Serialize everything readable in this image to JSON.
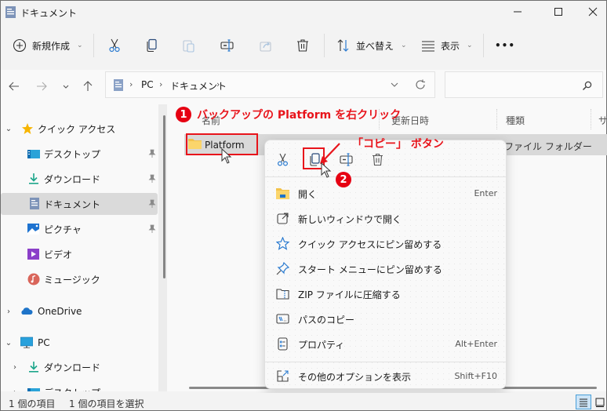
{
  "window": {
    "title": "ドキュメント",
    "controls": {
      "minimize": "minimize",
      "maximize": "maximize",
      "close": "close"
    }
  },
  "toolbar": {
    "new_label": "新規作成",
    "sort_label": "並べ替え",
    "view_label": "表示",
    "more_label": "•••",
    "icons": [
      "cut-icon",
      "copy-icon",
      "paste-icon",
      "rename-icon",
      "share-icon",
      "delete-icon"
    ]
  },
  "address": {
    "crumbs": [
      "PC",
      "ドキュメント"
    ],
    "search_placeholder": ""
  },
  "sidebar": {
    "items": [
      {
        "label": "クイック アクセス",
        "icon": "star-icon",
        "expanded": true
      },
      {
        "label": "デスクトップ",
        "icon": "desktop-icon",
        "pinned": true
      },
      {
        "label": "ダウンロード",
        "icon": "download-icon",
        "pinned": true
      },
      {
        "label": "ドキュメント",
        "icon": "document-icon",
        "pinned": true,
        "selected": true
      },
      {
        "label": "ピクチャ",
        "icon": "pictures-icon",
        "pinned": true
      },
      {
        "label": "ビデオ",
        "icon": "video-icon"
      },
      {
        "label": "ミュージック",
        "icon": "music-icon"
      },
      {
        "label": "OneDrive",
        "icon": "cloud-icon",
        "expanded": false
      },
      {
        "label": "PC",
        "icon": "pc-icon",
        "expanded": true
      },
      {
        "label": "ダウンロード",
        "icon": "download-icon",
        "expanded": false
      },
      {
        "label": "デスクトップ",
        "icon": "desktop-icon",
        "expanded": false
      }
    ]
  },
  "content": {
    "columns": [
      "名前",
      "更新日時",
      "種類",
      "サ"
    ],
    "rows": [
      {
        "name": "Platform",
        "type": "ファイル フォルダー",
        "selected": true
      }
    ]
  },
  "context_menu": {
    "quick_actions": [
      "cut-icon",
      "copy-icon",
      "rename-icon",
      "delete-icon"
    ],
    "items": [
      {
        "label": "開く",
        "shortcut": "Enter",
        "icon": "folder-open-icon"
      },
      {
        "label": "新しいウィンドウで開く",
        "shortcut": "",
        "icon": "open-new-window-icon"
      },
      {
        "label": "クイック アクセスにピン留めする",
        "shortcut": "",
        "icon": "star-outline-icon"
      },
      {
        "label": "スタート メニューにピン留めする",
        "shortcut": "",
        "icon": "pin-icon"
      },
      {
        "label": "ZIP ファイルに圧縮する",
        "shortcut": "",
        "icon": "zip-icon"
      },
      {
        "label": "パスのコピー",
        "shortcut": "",
        "icon": "copy-path-icon"
      },
      {
        "label": "プロパティ",
        "shortcut": "Alt+Enter",
        "icon": "properties-icon"
      },
      {
        "label": "その他のオプションを表示",
        "shortcut": "Shift+F10",
        "icon": "more-options-icon"
      }
    ]
  },
  "annotations": {
    "step1_number": "1",
    "step1_text": "バックアップの Platform を右クリック",
    "step2_number": "2",
    "step2_text": "「コピー」 ボタン",
    "color": "#e8141b"
  },
  "statusbar": {
    "item_count": "1 個の項目",
    "selected_count": "1 個の項目を選択"
  }
}
